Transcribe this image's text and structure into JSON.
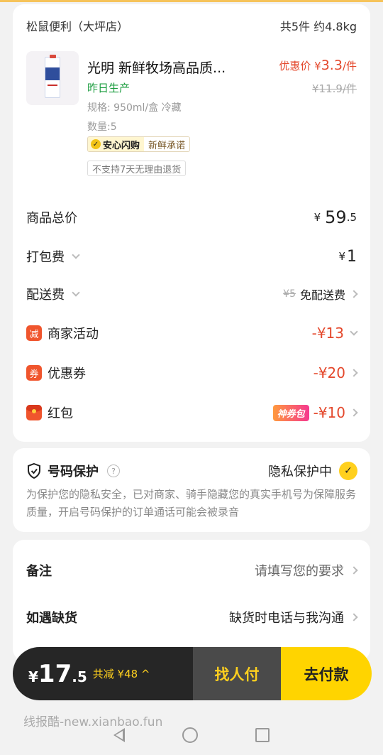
{
  "store": {
    "name": "松鼠便利（大坪店）",
    "summary": "共5件 约4.8kg"
  },
  "product": {
    "name": "光明 新鲜牧场高品质...",
    "freshness_tag": "昨日生产",
    "spec": "规格: 950ml/盒 冷藏",
    "quantity": "数量:5",
    "promise_a": "安心闪购",
    "promise_b": "新鲜承诺",
    "return_policy": "不支持7天无理由退货",
    "price_prefix": "优惠价 ¥",
    "price_value": "3.3",
    "price_unit": "/件",
    "original_price": "¥11.9/件"
  },
  "fees": {
    "goods_total": {
      "label": "商品总价",
      "currency": "¥",
      "int": "59",
      "dec": ".5"
    },
    "packing": {
      "label": "打包费",
      "currency": "¥",
      "amount": "1"
    },
    "delivery": {
      "label": "配送费",
      "original": "¥5",
      "value": "免配送费"
    },
    "merchant": {
      "icon_text": "减",
      "label": "商家活动",
      "value": "-¥13"
    },
    "coupon": {
      "icon_text": "券",
      "label": "优惠券",
      "value": "-¥20"
    },
    "redpacket": {
      "label": "红包",
      "badge": "神券包",
      "value": "-¥10"
    }
  },
  "privacy": {
    "title": "号码保护",
    "help": "?",
    "status": "隐私保护中",
    "check": "✓",
    "desc": "为保护您的隐私安全，已对商家、骑手隐藏您的真实手机号为保障服务质量，开启号码保护的订单通话可能会被录音"
  },
  "notes": {
    "remark_label": "备注",
    "remark_placeholder": "请填写您的要求",
    "stockout_label": "如遇缺货",
    "stockout_value": "缺货时电话与我沟通"
  },
  "paybar": {
    "currency": "¥",
    "total_int": "17",
    "total_dec": ".5",
    "discount": "共减 ¥48 ^",
    "friend_pay": "找人付",
    "pay": "去付款"
  },
  "watermark": "线报酷-new.xianbao.fun",
  "colors": {
    "accent_yellow": "#ffd400",
    "price_red": "#e4482c",
    "fresh_green": "#1a9c3e"
  }
}
